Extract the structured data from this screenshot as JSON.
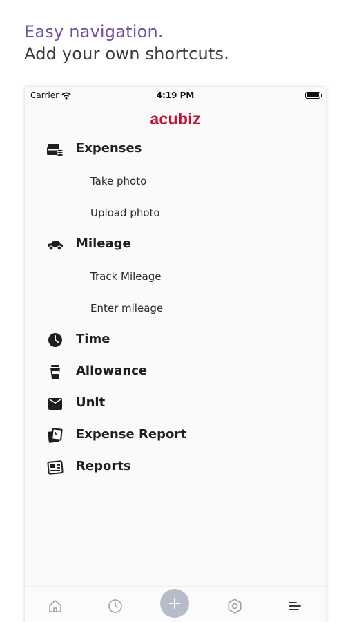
{
  "headline": {
    "line1": "Easy navigation.",
    "line2": "Add your own shortcuts."
  },
  "status_bar": {
    "carrier": "Carrier",
    "time": "4:19 PM"
  },
  "app": {
    "logo": "acubiz"
  },
  "menu": {
    "expenses": {
      "label": "Expenses",
      "icon": "expenses-icon"
    },
    "take_photo": "Take photo",
    "upload_photo": "Upload photo",
    "mileage": {
      "label": "Mileage",
      "icon": "car-icon"
    },
    "track_mileage": "Track Mileage",
    "enter_mileage": "Enter mileage",
    "time": {
      "label": "Time",
      "icon": "clock-icon"
    },
    "allowance": {
      "label": "Allowance",
      "icon": "cup-icon"
    },
    "unit": {
      "label": "Unit",
      "icon": "box-icon"
    },
    "expense_report": {
      "label": "Expense Report",
      "icon": "report-icon"
    },
    "reports": {
      "label": "Reports",
      "icon": "reports-icon"
    }
  },
  "tab_bar": {
    "tabs": [
      "home-icon",
      "history-icon",
      "add-icon",
      "settings-icon",
      "menu-icon"
    ],
    "active": "menu-icon"
  },
  "colors": {
    "headline_accent": "#6e4fa3",
    "logo": "#c8102e",
    "plus_button": "#b7bccb"
  }
}
